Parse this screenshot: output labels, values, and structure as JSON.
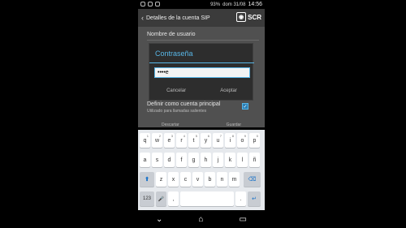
{
  "statusbar": {
    "battery": "93%",
    "date": "dom 31/08",
    "time": "14:56"
  },
  "appbar": {
    "title": "Detalles de la cuenta SIP",
    "scr": "SCR"
  },
  "settings": {
    "username_label": "Nombre de usuario",
    "default_label": "Definir como cuenta principal",
    "default_sub": "Utilizado para llamadas salientes",
    "cancel_bottom": "Descartar",
    "save_bottom": "Guardar"
  },
  "dialog": {
    "title": "Contraseña",
    "value": "••••e",
    "cancel": "Cancelar",
    "accept": "Aceptar"
  },
  "keyboard": {
    "row1": [
      "q",
      "w",
      "e",
      "r",
      "t",
      "y",
      "u",
      "i",
      "o",
      "p"
    ],
    "row1_alt": [
      "1",
      "2",
      "3",
      "4",
      "5",
      "6",
      "7",
      "8",
      "9",
      "0"
    ],
    "row2": [
      "a",
      "s",
      "d",
      "f",
      "g",
      "h",
      "j",
      "k",
      "l",
      "ñ"
    ],
    "row3": [
      "z",
      "x",
      "c",
      "v",
      "b",
      "n",
      "m"
    ],
    "shift": "⬆",
    "backspace": "⌫",
    "mode": "123",
    "mic": "🎤",
    "comma": ",",
    "period": ".",
    "enter": "↵"
  },
  "navbar": {
    "back": "⌄",
    "home": "⌂",
    "recent": "▭"
  }
}
